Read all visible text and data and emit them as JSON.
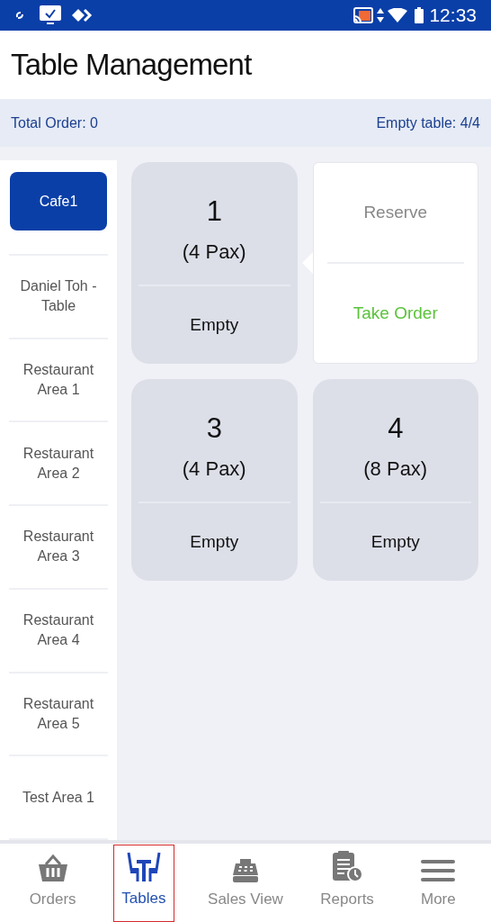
{
  "status_bar": {
    "time": "12:33"
  },
  "header": {
    "title": "Table Management"
  },
  "summary": {
    "total_order": "Total Order: 0",
    "empty_tables": "Empty table: 4/4"
  },
  "areas": [
    {
      "label": "Cafe1",
      "selected": true
    },
    {
      "label": "Daniel Toh - Table",
      "selected": false
    },
    {
      "label": "Restaurant Area 1",
      "selected": false
    },
    {
      "label": "Restaurant Area 2",
      "selected": false
    },
    {
      "label": "Restaurant Area 3",
      "selected": false
    },
    {
      "label": "Restaurant Area 4",
      "selected": false
    },
    {
      "label": "Restaurant Area 5",
      "selected": false
    },
    {
      "label": "Test Area 1",
      "selected": false
    }
  ],
  "tables": [
    {
      "kind": "table",
      "number": "1",
      "pax": "(4 Pax)",
      "status": "Empty"
    },
    {
      "kind": "menu",
      "options": [
        "Reserve",
        "Take Order"
      ]
    },
    {
      "kind": "table",
      "number": "3",
      "pax": "(4 Pax)",
      "status": "Empty"
    },
    {
      "kind": "table",
      "number": "4",
      "pax": "(8 Pax)",
      "status": "Empty"
    }
  ],
  "nav": [
    {
      "label": "Orders",
      "selected": false
    },
    {
      "label": "Tables",
      "selected": true
    },
    {
      "label": "Sales View",
      "selected": false
    },
    {
      "label": "Reports",
      "selected": false
    },
    {
      "label": "More",
      "selected": false
    }
  ]
}
